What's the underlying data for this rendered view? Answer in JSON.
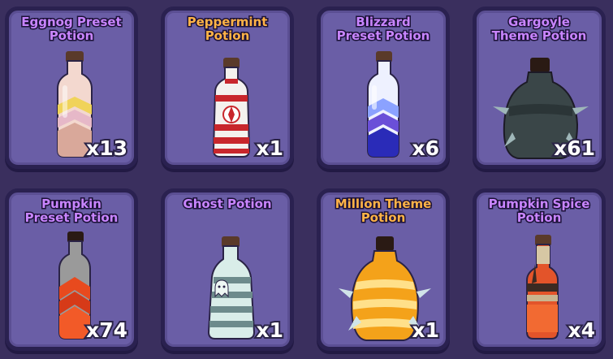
{
  "potions": [
    {
      "name": "Eggnog Preset\nPotion",
      "qty": "x13",
      "name_color": "purple",
      "icon": "eggnog-potion"
    },
    {
      "name": "Peppermint\nPotion",
      "qty": "x1",
      "name_color": "orange",
      "icon": "peppermint-potion"
    },
    {
      "name": "Blizzard\nPreset Potion",
      "qty": "x6",
      "name_color": "purple",
      "icon": "blizzard-potion"
    },
    {
      "name": "Gargoyle\nTheme Potion",
      "qty": "x61",
      "name_color": "purple",
      "icon": "gargoyle-potion"
    },
    {
      "name": "Pumpkin\nPreset Potion",
      "qty": "x74",
      "name_color": "purple",
      "icon": "pumpkin-potion"
    },
    {
      "name": "Ghost Potion",
      "qty": "x1",
      "name_color": "purple",
      "icon": "ghost-potion"
    },
    {
      "name": "Million Theme\nPotion",
      "qty": "x1",
      "name_color": "orange",
      "icon": "million-potion"
    },
    {
      "name": "Pumpkin Spice\nPotion",
      "qty": "x4",
      "name_color": "purple",
      "icon": "pumpkin-spice-potion"
    }
  ],
  "colors": {
    "background": "#3a2f5e",
    "card": "#6a5ea6",
    "card_border": "#2a2150",
    "name_purple": "#c985ff",
    "name_orange": "#ffb347"
  }
}
